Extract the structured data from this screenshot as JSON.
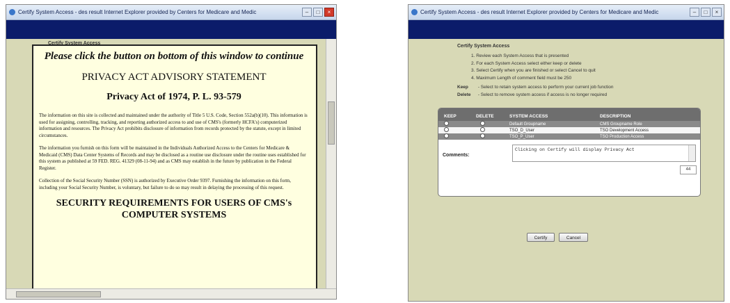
{
  "left_window": {
    "title": "Certify System Access - des result Internet Explorer provided by Centers for Medicare and Medic",
    "behind_text": "Certify System Access",
    "modal": {
      "click_prompt": "Please click the button on bottom of this window to continue",
      "heading": "PRIVACY ACT ADVISORY STATEMENT",
      "subheading": "Privacy Act of 1974, P. L. 93-579",
      "paragraphs": [
        "The information on this site is collected and maintained under the authority of Title 5 U.S. Code, Section 552a(b)(10). This information is used for assigning, controlling, tracking, and reporting authorized access to and use of CMS's (formerly HCFA's) computerized information and resources. The Privacy Act prohibits disclosure of information from records protected by the statute, except in limited circumstances.",
        "The information you furnish on this form will be maintained in the Individuals Authorized Access to the Centers for Medicare & Medicaid (CMS) Data Center Systems of Records and may be disclosed as a routine use disclosure under the routine uses established for this system as published at 59 FED. REG. 41329 (08-11-94) and as CMS may establish in the future by publication in the Federal Register.",
        "Collection of the Social Security Number (SSN) is authorized by Executive Order 9397. Furnishing the information on this form, including your Social Security Number, is voluntary, but failure to do so may result in delaying the processing of this request."
      ],
      "security_heading": "SECURITY REQUIREMENTS FOR USERS OF CMS's COMPUTER SYSTEMS"
    }
  },
  "right_window": {
    "title": "Certify System Access - des result Internet Explorer provided by Centers for Medicare and Medic",
    "page_title": "Certify System Access",
    "instructions": [
      "1. Review each System Access that is presented",
      "2. For each System Access select either keep or delete",
      "3. Select Certify when you are finished or select Cancel to quit",
      "4. Maximum Length of comment field must be 250"
    ],
    "keep_label": "Keep",
    "keep_desc": "- Select to retain system access to perform your current job function",
    "delete_label": "Delete",
    "delete_desc": "- Select to remove system access if access is no longer required",
    "table": {
      "headers": [
        "KEEP",
        "DELETE",
        "SYSTEM ACCESS",
        "DESCRIPTION"
      ],
      "rows": [
        {
          "access": "Default Groupname",
          "description": "CMS Groupname Role"
        },
        {
          "access": "TSO_D_User",
          "description": "TSO Development Access"
        },
        {
          "access": "TSO_P_User",
          "description": "TSO Production Access"
        }
      ]
    },
    "comments_label": "Comments:",
    "comments_value": "Clicking on Certify will display Privacy Act",
    "char_count": "44",
    "certify_label": "Certify",
    "cancel_label": "Cancel"
  }
}
